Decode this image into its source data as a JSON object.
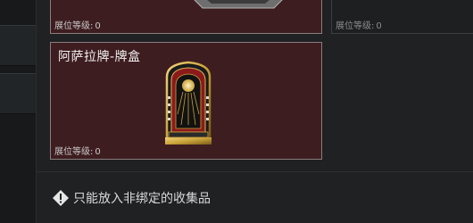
{
  "cards": [
    {
      "title": "",
      "level_label": "展位等级:",
      "level_value": "0"
    },
    {
      "title": "",
      "level_label": "展位等级:",
      "level_value": "0"
    },
    {
      "title": "阿萨拉牌-牌盒",
      "level_label": "展位等级:",
      "level_value": "0",
      "item_icon": "card-box-icon"
    }
  ],
  "notice": {
    "icon": "warning-icon",
    "text": "只能放入非绑定的收集品"
  },
  "colors": {
    "card_selected_bg": "#3e1d20",
    "card_border": "#8a7c7c",
    "item_gold": "#c9a23a",
    "item_red": "#8b1a1a"
  }
}
